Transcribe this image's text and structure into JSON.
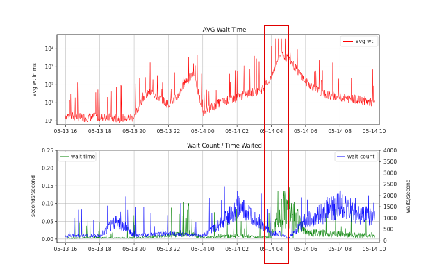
{
  "chart_data": [
    {
      "type": "line",
      "title": "AVG Wait Time",
      "xlabel": "",
      "ylabel": "avg wt in ms",
      "yscale": "log",
      "ylim": [
        0.6,
        60000
      ],
      "yticks": [
        1,
        10,
        100,
        1000,
        10000
      ],
      "ytick_labels": [
        "10⁰",
        "10¹",
        "10²",
        "10³",
        "10⁴"
      ],
      "x_ticks": [
        "05-13 16",
        "05-13 18",
        "05-13 20",
        "05-13 22",
        "05-14 00",
        "05-14 02",
        "05-14 04",
        "05-14 06",
        "05-14 08",
        "05-14 10"
      ],
      "xlim_hours": [
        15.5,
        34.3
      ],
      "grid": true,
      "legend": {
        "position": "top-right",
        "entries": [
          "avg wt"
        ]
      },
      "series": [
        {
          "name": "avg wt",
          "color": "#ff0000",
          "x_hours": [
            16.0,
            17.0,
            18.0,
            19.0,
            20.0,
            20.5,
            21.0,
            22.0,
            22.5,
            23.0,
            23.5,
            24.0,
            25.0,
            26.0,
            27.0,
            27.5,
            28.0,
            28.5,
            29.0,
            30.0,
            31.0,
            32.0,
            33.0,
            34.0
          ],
          "values": [
            2.0,
            1.5,
            1.6,
            1.4,
            1.5,
            20.0,
            40.0,
            8.0,
            20.0,
            150.0,
            400.0,
            3.0,
            10.0,
            20.0,
            40.0,
            60.0,
            250.0,
            5000.0,
            3000.0,
            150.0,
            30.0,
            20.0,
            15.0,
            10.0
          ]
        }
      ]
    },
    {
      "type": "line",
      "title": "Wait Count / Time Waited",
      "xlabel": "",
      "ylabel": "seconds/second",
      "ylabel_right": "waits/second",
      "ylim": [
        -0.01,
        0.25
      ],
      "yticks": [
        0.0,
        0.05,
        0.1,
        0.15,
        0.2,
        0.25
      ],
      "ytick_labels": [
        "0.00",
        "0.05",
        "0.10",
        "0.15",
        "0.20",
        "0.25"
      ],
      "ylim_right": [
        -100,
        4000
      ],
      "yticks_right": [
        0,
        500,
        1000,
        1500,
        2000,
        2500,
        3000,
        3500,
        4000
      ],
      "ytick_labels_right": [
        "0",
        "500",
        "1000",
        "1500",
        "2000",
        "2500",
        "3000",
        "3500",
        "4000"
      ],
      "x_ticks": [
        "05-13 16",
        "05-13 18",
        "05-13 20",
        "05-13 22",
        "05-14 00",
        "05-14 02",
        "05-14 04",
        "05-14 06",
        "05-14 08",
        "05-14 10"
      ],
      "xlim_hours": [
        15.5,
        34.3
      ],
      "grid": true,
      "legend": [
        {
          "position": "top-left",
          "entries": [
            "wait time"
          ]
        },
        {
          "position": "top-right",
          "entries": [
            "wait count"
          ]
        }
      ],
      "series": [
        {
          "name": "wait time",
          "axis": "left",
          "color": "#008000",
          "x_hours": [
            16.0,
            18.0,
            20.0,
            22.0,
            23.0,
            24.0,
            26.0,
            28.0,
            28.5,
            29.0,
            30.0,
            32.0,
            34.0
          ],
          "values": [
            0.003,
            0.004,
            0.004,
            0.01,
            0.02,
            0.005,
            0.01,
            0.005,
            0.08,
            0.1,
            0.02,
            0.015,
            0.01
          ]
        },
        {
          "name": "wait count",
          "axis": "right",
          "color": "#0000ff",
          "x_hours": [
            16.0,
            18.0,
            19.0,
            20.0,
            22.0,
            24.0,
            25.0,
            26.0,
            27.0,
            28.0,
            28.5,
            29.0,
            30.0,
            31.0,
            32.0,
            33.0,
            34.0
          ],
          "values": [
            200.0,
            200.0,
            900.0,
            200.0,
            300.0,
            200.0,
            700.0,
            1500.0,
            1000.0,
            300.0,
            300.0,
            100.0,
            900.0,
            1200.0,
            1600.0,
            1200.0,
            1000.0
          ]
        }
      ]
    }
  ]
}
